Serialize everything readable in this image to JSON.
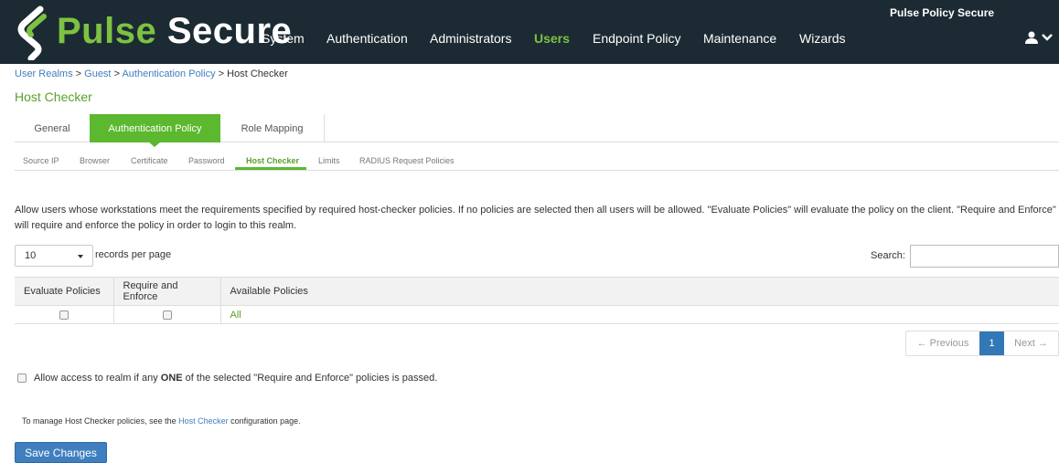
{
  "brand": {
    "logo_word_1": "Pulse",
    "logo_word_2": "Secure",
    "product_name": "Pulse Policy Secure",
    "accent_color": "#7dc242",
    "header_bg": "#1c2b33"
  },
  "nav": {
    "items": [
      {
        "label": "System"
      },
      {
        "label": "Authentication"
      },
      {
        "label": "Administrators"
      },
      {
        "label": "Users",
        "active": true
      },
      {
        "label": "Endpoint Policy"
      },
      {
        "label": "Maintenance"
      },
      {
        "label": "Wizards"
      }
    ],
    "user_icon": "user-icon"
  },
  "breadcrumb": {
    "items": [
      "User Realms",
      "Guest",
      "Authentication Policy",
      "Host Checker"
    ],
    "separator": ">"
  },
  "page_title": "Host Checker",
  "tabs": [
    {
      "label": "General"
    },
    {
      "label": "Authentication Policy",
      "active": true
    },
    {
      "label": "Role Mapping"
    }
  ],
  "subtabs": [
    {
      "label": "Source IP"
    },
    {
      "label": "Browser"
    },
    {
      "label": "Certificate"
    },
    {
      "label": "Password"
    },
    {
      "label": "Host Checker",
      "active": true
    },
    {
      "label": "Limits"
    },
    {
      "label": "RADIUS Request Policies"
    }
  ],
  "description": "Allow users whose workstations meet the requirements specified by required host-checker policies. If no policies are selected then all users will be allowed. \"Evaluate Policies\" will evaluate the policy on the client. \"Require and Enforce\" will require and enforce the policy in order to login to this realm.",
  "table_controls": {
    "page_length": "10",
    "records_label": "records per page",
    "search_label": "Search:",
    "search_value": ""
  },
  "table": {
    "columns": [
      "Evaluate Policies",
      "Require and Enforce",
      "Available Policies"
    ],
    "rows": [
      {
        "evaluate": false,
        "enforce": false,
        "policy": "All"
      }
    ]
  },
  "pagination": {
    "previous": "← Previous",
    "current": "1",
    "next": "Next →"
  },
  "allow_option": {
    "checked": false,
    "prefix": "Allow access to realm if any ",
    "emphasis": "ONE",
    "suffix": " of the selected \"Require and Enforce\" policies is passed."
  },
  "manage_note": {
    "prefix": "To manage Host Checker policies, see the ",
    "link": "Host Checker",
    "suffix": " configuration page."
  },
  "save_button": "Save Changes"
}
